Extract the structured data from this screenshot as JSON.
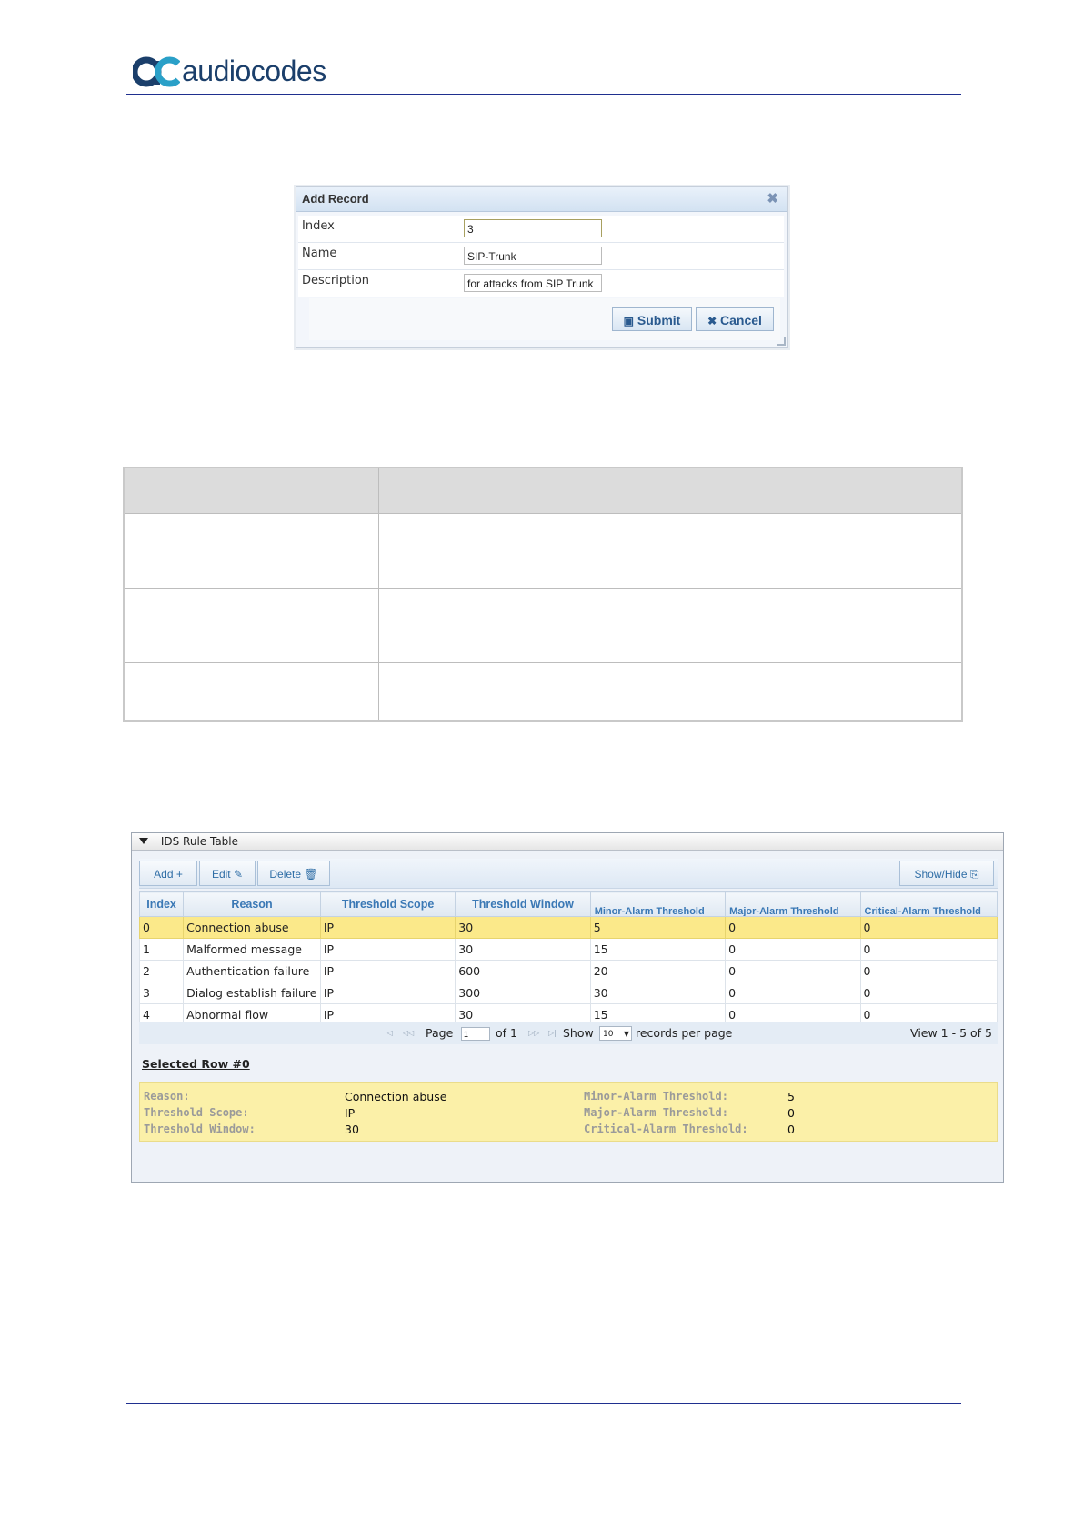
{
  "header": {
    "brand": "audiocodes"
  },
  "dialog": {
    "title": "Add Record",
    "fields": [
      {
        "label": "Index",
        "value": "3"
      },
      {
        "label": "Name",
        "value": "SIP-Trunk"
      },
      {
        "label": "Description",
        "value": "for attacks from SIP Trunk"
      }
    ],
    "submit_label": "Submit",
    "cancel_label": "Cancel"
  },
  "ids_table": {
    "title": "IDS Rule Table",
    "toolbar": {
      "add": "Add +",
      "edit": "Edit ✎",
      "delete": "Delete 🗑",
      "show_hide": "Show/Hide"
    },
    "columns": [
      "Index",
      "Reason",
      "Threshold Scope",
      "Threshold Window",
      "Minor-Alarm Threshold",
      "Major-Alarm Threshold",
      "Critical-Alarm Threshold"
    ],
    "rows": [
      {
        "index": "0",
        "reason": "Connection abuse",
        "scope": "IP",
        "window": "30",
        "minor": "5",
        "major": "0",
        "critical": "0"
      },
      {
        "index": "1",
        "reason": "Malformed message",
        "scope": "IP",
        "window": "30",
        "minor": "15",
        "major": "0",
        "critical": "0"
      },
      {
        "index": "2",
        "reason": "Authentication failure",
        "scope": "IP",
        "window": "600",
        "minor": "20",
        "major": "0",
        "critical": "0"
      },
      {
        "index": "3",
        "reason": "Dialog establish failure",
        "scope": "IP",
        "window": "300",
        "minor": "30",
        "major": "0",
        "critical": "0"
      },
      {
        "index": "4",
        "reason": "Abnormal flow",
        "scope": "IP",
        "window": "30",
        "minor": "15",
        "major": "0",
        "critical": "0"
      }
    ],
    "pager": {
      "page_label": "Page",
      "page_value": "1",
      "of_label": "of 1",
      "show_label": "Show",
      "per_page_value": "10",
      "records_label": "records per page",
      "view_label": "View 1 - 5 of 5"
    },
    "selected_row_label": "Selected Row #0",
    "details": {
      "reason_label": "Reason:",
      "reason_value": "Connection abuse",
      "scope_label": "Threshold Scope:",
      "scope_value": "IP",
      "window_label": "Threshold Window:",
      "window_value": "30",
      "minor_label": "Minor-Alarm Threshold:",
      "minor_value": "5",
      "major_label": "Major-Alarm Threshold:",
      "major_value": "0",
      "critical_label": "Critical-Alarm Threshold:",
      "critical_value": "0"
    }
  },
  "colors": {
    "brand_blue": "#1b3f6b",
    "brand_teal": "#2aa0c8",
    "rule_line": "#1f2f8f",
    "selected_row": "#fbe98a",
    "header_link": "#3a78b5"
  }
}
